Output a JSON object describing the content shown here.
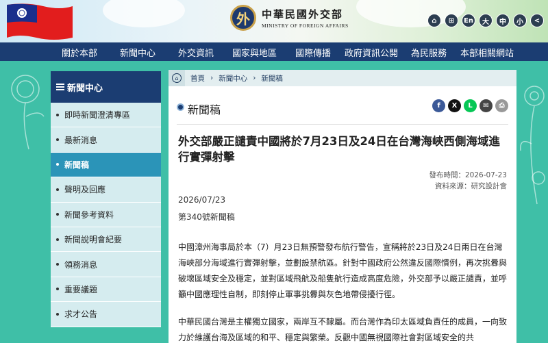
{
  "header": {
    "logo_zh": "中華民國外交部",
    "logo_en": "MINISTRY OF FOREIGN AFFAIRS",
    "tools": [
      {
        "icon": "home-icon",
        "label": "⌂"
      },
      {
        "icon": "sitemap-icon",
        "label": "⊞"
      },
      {
        "icon": "language-icon",
        "label": "En"
      },
      {
        "icon": "font-large-icon",
        "label": "大"
      },
      {
        "icon": "font-medium-icon",
        "label": "中"
      },
      {
        "icon": "font-small-icon",
        "label": "小"
      },
      {
        "icon": "share-icon",
        "label": "<"
      }
    ]
  },
  "nav": [
    "關於本部",
    "新聞中心",
    "外交資訊",
    "國家與地區",
    "國際傳播",
    "政府資訊公開",
    "為民服務",
    "本部相關網站"
  ],
  "sidebar": {
    "title": "新聞中心",
    "items": [
      "即時新聞澄清專區",
      "最新消息",
      "新聞稿",
      "聲明及回應",
      "新聞參考資料",
      "新聞說明會紀要",
      "領務消息",
      "重要議題",
      "求才公告"
    ],
    "active_index": 2
  },
  "breadcrumb": [
    "首頁",
    "新聞中心",
    "新聞稿"
  ],
  "section_title": "新聞稿",
  "share_buttons": [
    {
      "icon": "facebook-icon",
      "label": "f",
      "color": "#3b5998"
    },
    {
      "icon": "x-icon",
      "label": "X",
      "color": "#111111"
    },
    {
      "icon": "line-icon",
      "label": "L",
      "color": "#06c755"
    },
    {
      "icon": "email-icon",
      "label": "✉",
      "color": "#444444"
    },
    {
      "icon": "print-icon",
      "label": "⎙",
      "color": "#999999"
    }
  ],
  "article": {
    "headline": "外交部嚴正譴責中國將於7月23日及24日在台灣海峽西側海域進行實彈射擊",
    "publish_time": "發布時間：2026-07-23",
    "source": "資料來源：研究設計會",
    "date": "2026/07/23",
    "number": "第340號新聞稿",
    "paragraph1": "中國漳州海事局於本（7）月23日無預警發布航行警告，宣稱將於23日及24日兩日在台灣海峽部分海域進行實彈射擊，並劃設禁航區。針對中國政府公然違反國際慣例，再次挑釁與破壞區域安全及穩定，並對區域飛航及船隻航行造成高度危險，外交部予以嚴正譴責，並呼籲中國應理性自制，即刻停止軍事挑釁與灰色地帶侵擾行徑。",
    "paragraph2": "中華民國台灣是主權獨立國家，兩岸互不隸屬。而台灣作為印太區域負責任的成員，一向致力於維護台海及區域的和平、穩定與繁榮。反觀中國無視國際社會對區域安全的共"
  },
  "colors": {
    "navy": "#1b3d72",
    "teal_bg": "#3fbfa7",
    "active": "#2b94b8"
  }
}
